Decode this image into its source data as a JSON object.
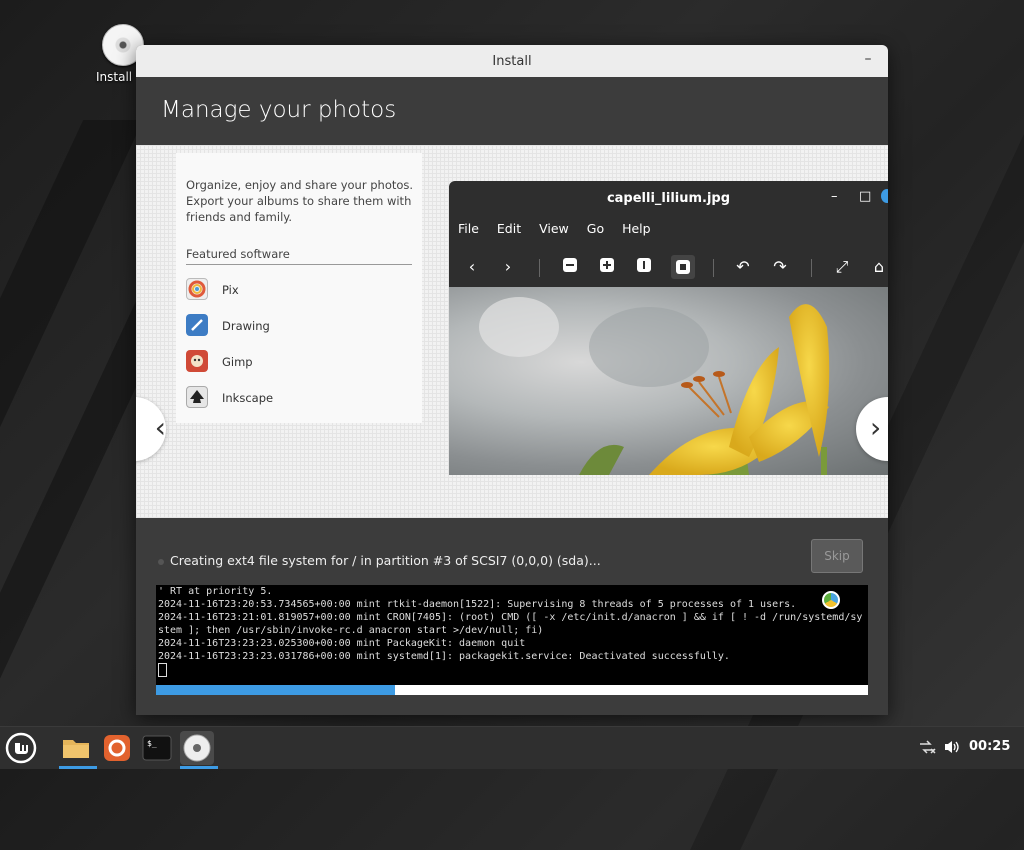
{
  "desktop": {
    "icon_label": "Install"
  },
  "window": {
    "title": "Install",
    "minimize_label": "–"
  },
  "slide": {
    "heading": "Manage your photos",
    "description": "Organize, enjoy and share your photos. Export your albums to share them with friends and family.",
    "featured_label": "Featured software",
    "apps": [
      {
        "name": "Pix",
        "icon": "pix-icon"
      },
      {
        "name": "Drawing",
        "icon": "drawing-icon"
      },
      {
        "name": "Gimp",
        "icon": "gimp-icon"
      },
      {
        "name": "Inkscape",
        "icon": "inkscape-icon"
      }
    ],
    "prev_arrow": "‹",
    "next_arrow": "›"
  },
  "viewer": {
    "title": "capelli_lilium.jpg",
    "menu": [
      "File",
      "Edit",
      "View",
      "Go",
      "Help"
    ],
    "controls": {
      "minimize": "–",
      "maximize": "□"
    }
  },
  "status": {
    "text": "Creating ext4 file system for / in partition #3 of SCSI7 (0,0,0) (sda)...",
    "skip_label": "Skip"
  },
  "terminal": {
    "lines": [
      "' RT at priority 5.",
      "2024-11-16T23:20:53.734565+00:00 mint rtkit-daemon[1522]: Supervising 8 threads of 5 processes of 1 users.",
      "2024-11-16T23:21:01.819057+00:00 mint CRON[7405]: (root) CMD ([ -x /etc/init.d/anacron ] && if [ ! -d /run/systemd/system ]; then /usr/sbin/invoke-rc.d anacron start >/dev/null; fi)",
      "2024-11-16T23:23:23.025300+00:00 mint PackageKit: daemon quit",
      "2024-11-16T23:23:23.031786+00:00 mint systemd[1]: packagekit.service: Deactivated successfully."
    ]
  },
  "progress": {
    "fraction": 0.335,
    "color": "#3d9be4"
  },
  "taskbar": {
    "clock": "00:25"
  }
}
